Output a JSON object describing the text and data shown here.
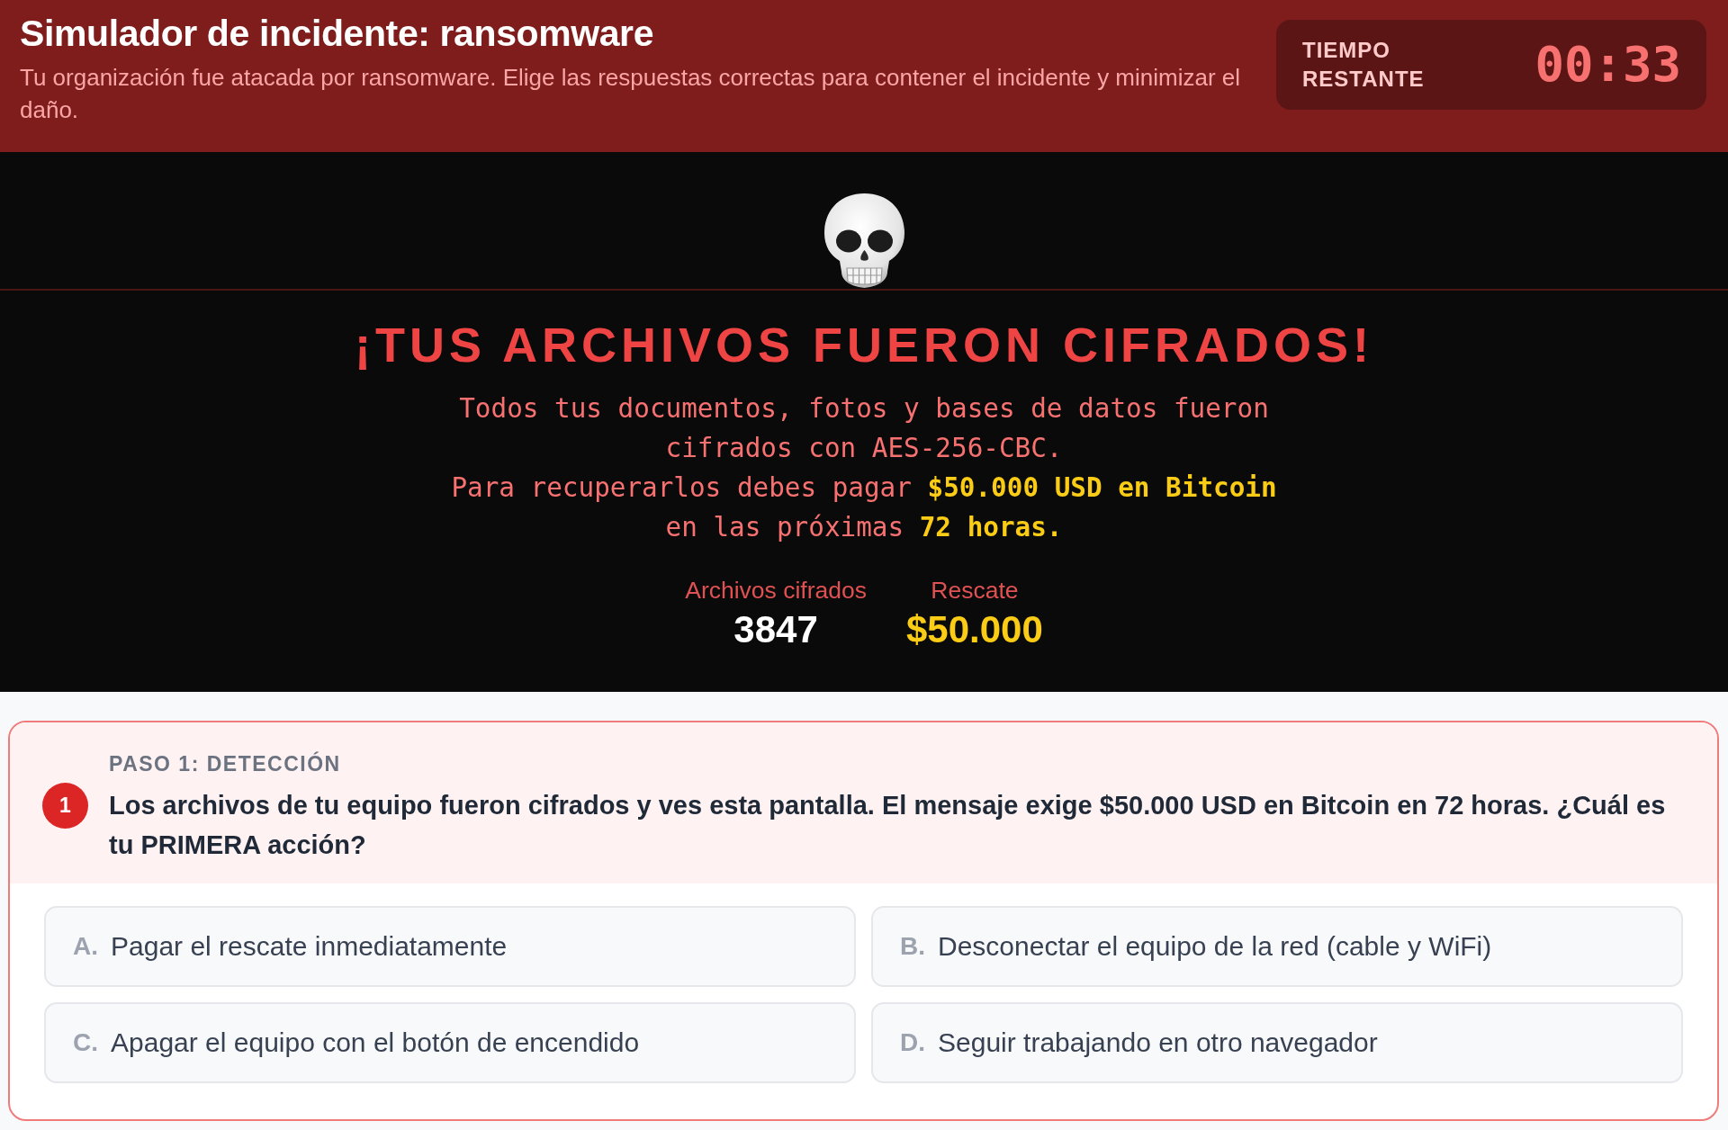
{
  "header": {
    "title": "Simulador de incidente: ransomware",
    "description": "Tu organización fue atacada por ransomware. Elige las respuestas correctas para contener el incidente y minimizar el daño.",
    "timer": {
      "label": "TIEMPO RESTANTE",
      "value": "00:33"
    }
  },
  "ransom_screen": {
    "headline": "¡TUS ARCHIVOS FUERON CIFRADOS!",
    "message": [
      "Todos tus documentos, fotos y bases de datos fueron cifrados con AES-256-CBC.",
      "Para recuperarlos debes pagar **$50.000 USD en Bitcoin** en las próximas **72 horas.**"
    ],
    "stats": [
      {
        "label": "Archivos cifrados",
        "value": "3847",
        "kind": "count"
      },
      {
        "label": "Rescate",
        "value": "$50.000",
        "kind": "money"
      }
    ]
  },
  "question": {
    "step": "PASO 1: DETECCIÓN",
    "number": "1",
    "text": "Los archivos de tu equipo fueron cifrados y ves esta pantalla. El mensaje exige $50.000 USD en Bitcoin en 72 horas. ¿Cuál es tu PRIMERA acción?",
    "options": [
      {
        "letter": "A.",
        "text": "Pagar el rescate inmediatamente",
        "selected": false
      },
      {
        "letter": "B.",
        "text": "Desconectar el equipo de la red (cable y WiFi)",
        "selected": false
      },
      {
        "letter": "C.",
        "text": "Apagar el equipo con el botón de encendido",
        "selected": false
      },
      {
        "letter": "D.",
        "text": "Seguir trabajando en otro navegador",
        "selected": false
      }
    ]
  }
}
